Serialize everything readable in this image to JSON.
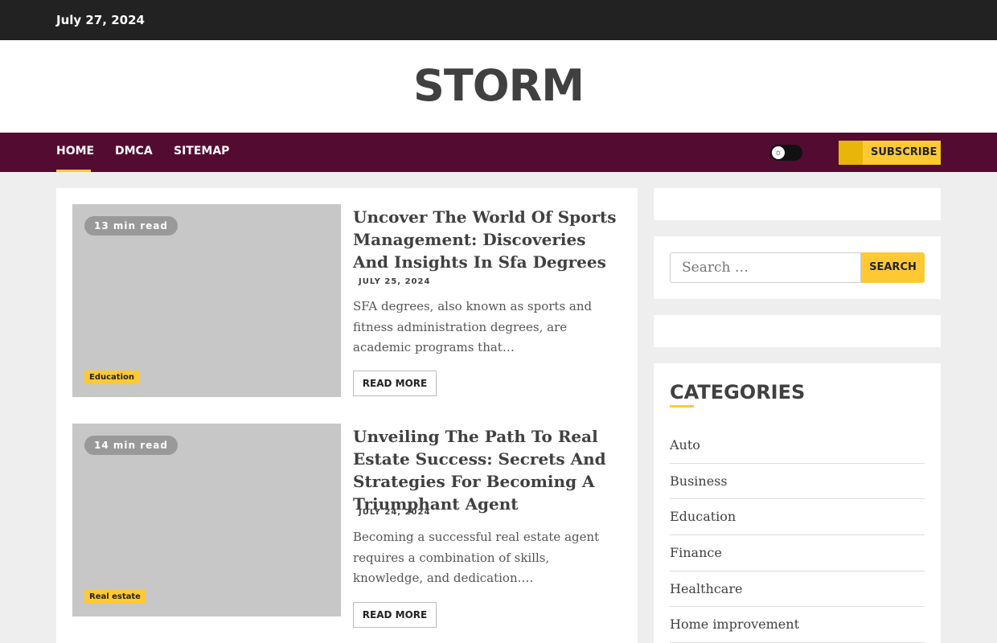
{
  "topbar": {
    "date": "July 27, 2024"
  },
  "site": {
    "title": "STORM"
  },
  "nav": {
    "items": [
      "HOME",
      "DMCA",
      "SITEMAP"
    ],
    "subscribe_label": "SUBSCRIBE"
  },
  "posts": [
    {
      "read_time": "13 min read",
      "category": "Education",
      "title": "Uncover The World Of Sports Management: Discoveries And Insights In Sfa Degrees",
      "date": "JULY 25, 2024",
      "excerpt": "SFA degrees, also known as sports and fitness administration degrees, are academic programs that…",
      "read_more": "READ MORE"
    },
    {
      "read_time": "14 min read",
      "category": "Real estate",
      "title": "Unveiling The Path To Real Estate Success: Secrets And Strategies For Becoming A Triumphant Agent",
      "date": "JULY 24, 2024",
      "excerpt": "Becoming a successful real estate agent requires a combination of skills, knowledge, and dedication.…",
      "read_more": "READ MORE"
    }
  ],
  "search": {
    "placeholder": "Search …",
    "button": "SEARCH"
  },
  "categories": {
    "title": "CATEGORIES",
    "items": [
      "Auto",
      "Business",
      "Education",
      "Finance",
      "Healthcare",
      "Home improvement"
    ]
  },
  "colors": {
    "topbar": "#222222",
    "nav": "#540b32",
    "accent": "#ffc934",
    "background": "#eeeeee"
  }
}
